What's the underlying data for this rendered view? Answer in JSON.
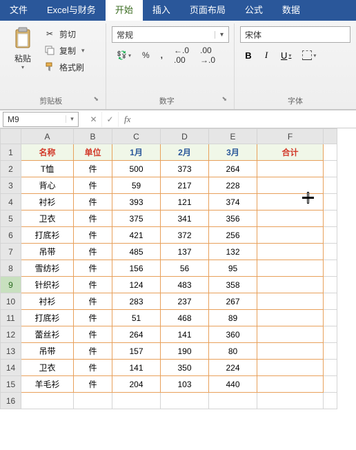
{
  "menu": {
    "tabs": [
      "文件",
      "Excel与财务",
      "开始",
      "插入",
      "页面布局",
      "公式",
      "数据"
    ],
    "active_index": 2
  },
  "ribbon": {
    "clipboard": {
      "paste": "粘贴",
      "cut": "剪切",
      "copy": "复制",
      "painter": "格式刷",
      "group_label": "剪贴板"
    },
    "number": {
      "format": "常规",
      "currency": "💱",
      "percent": "%",
      "comma": ",",
      "inc_dec": "⁰⁰",
      "dec_dec": "⁰⁰",
      "group_label": "数字"
    },
    "font": {
      "name": "宋体",
      "bold": "B",
      "italic": "I",
      "underline": "U",
      "group_label": "字体"
    }
  },
  "namebox": {
    "value": "M9"
  },
  "fx": {
    "cancel": "✕",
    "confirm": "✓",
    "fx": "fx"
  },
  "col_headers": [
    "A",
    "B",
    "C",
    "D",
    "E",
    "F"
  ],
  "row_headers": [
    "1",
    "2",
    "3",
    "4",
    "5",
    "6",
    "7",
    "8",
    "9",
    "10",
    "11",
    "12",
    "13",
    "14",
    "15",
    "16"
  ],
  "selected_row_header_index": 8,
  "chart_data": {
    "type": "table",
    "headers": [
      "名称",
      "单位",
      "1月",
      "2月",
      "3月",
      "合计"
    ],
    "rows": [
      [
        "T恤",
        "件",
        500,
        373,
        264,
        null
      ],
      [
        "背心",
        "件",
        59,
        217,
        228,
        null
      ],
      [
        "衬衫",
        "件",
        393,
        121,
        374,
        null
      ],
      [
        "卫衣",
        "件",
        375,
        341,
        356,
        null
      ],
      [
        "打底衫",
        "件",
        421,
        372,
        256,
        null
      ],
      [
        "吊带",
        "件",
        485,
        137,
        132,
        null
      ],
      [
        "雪纺衫",
        "件",
        156,
        56,
        95,
        null
      ],
      [
        "针织衫",
        "件",
        124,
        483,
        358,
        null
      ],
      [
        "衬衫",
        "件",
        283,
        237,
        267,
        null
      ],
      [
        "打底衫",
        "件",
        51,
        468,
        89,
        null
      ],
      [
        "蕾丝衫",
        "件",
        264,
        141,
        360,
        null
      ],
      [
        "吊带",
        "件",
        157,
        190,
        80,
        null
      ],
      [
        "卫衣",
        "件",
        141,
        350,
        224,
        null
      ],
      [
        "羊毛衫",
        "件",
        204,
        103,
        440,
        null
      ]
    ]
  }
}
